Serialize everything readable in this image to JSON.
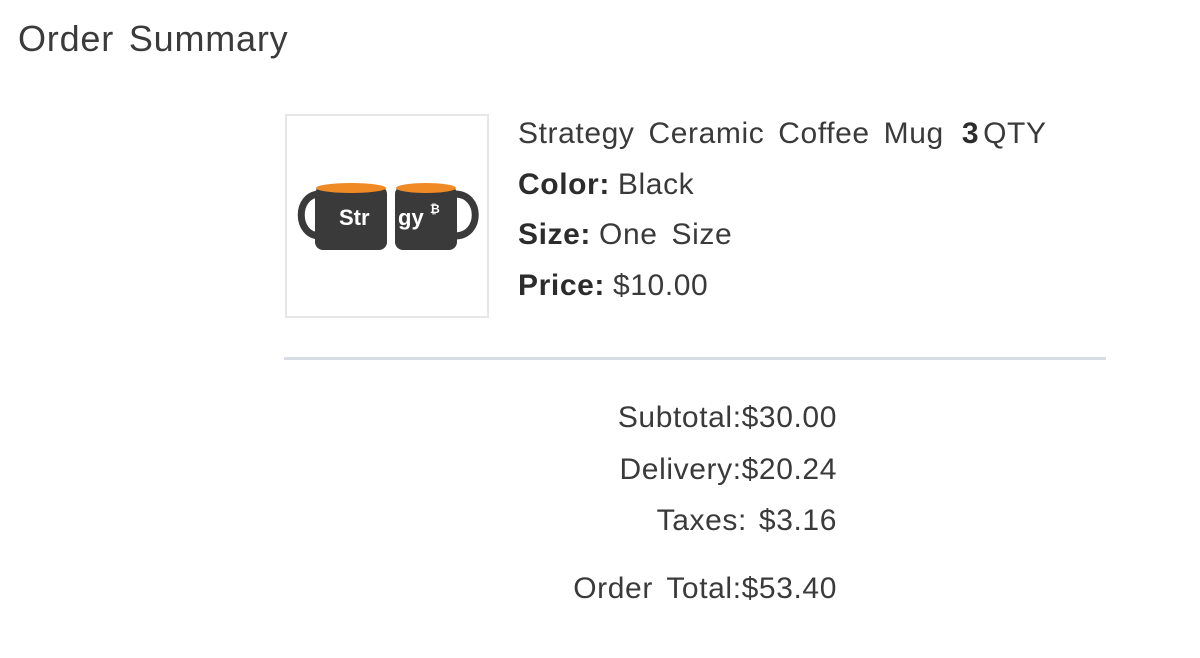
{
  "page": {
    "title": "Order Summary"
  },
  "product": {
    "name": "Strategy Ceramic Coffee Mug",
    "quantity": "3",
    "quantity_unit": "QTY",
    "color_label": "Color:",
    "color_value": "Black",
    "size_label": "Size:",
    "size_value": "One Size",
    "price_label": "Price:",
    "price_value": "$10.00",
    "image": {
      "mug_text_left": "Str",
      "mug_text_right": "gy",
      "mug_symbol": "₿",
      "mug_color": "#3a3a3a",
      "mug_inner_color": "#f08a24"
    }
  },
  "totals": {
    "subtotal_label": "Subtotal:",
    "subtotal_value": "$30.00",
    "delivery_label": "Delivery:",
    "delivery_value": "$20.24",
    "taxes_label": "Taxes:",
    "taxes_value": "$3.16",
    "order_total_label": "Order Total:",
    "order_total_value": "$53.40"
  }
}
